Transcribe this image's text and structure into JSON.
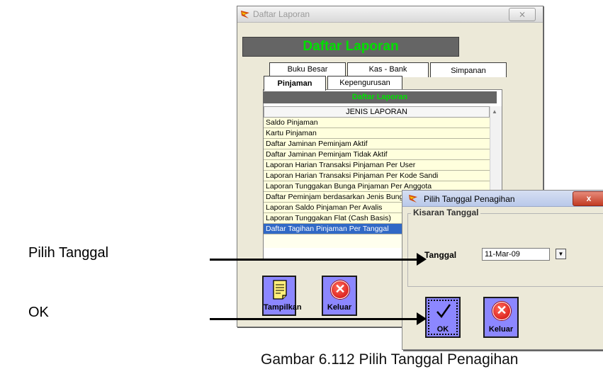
{
  "main_window": {
    "title": "Daftar Laporan",
    "close_glyph": "⨯",
    "header": "Daftar Laporan",
    "tabs_row1": [
      "Buku Besar",
      "Kas - Bank",
      "Simpanan"
    ],
    "tabs_row2": [
      "Pinjaman",
      "Kepengurusan"
    ],
    "active_tab": "Pinjaman",
    "sub_header": "Daftar Laporan",
    "list_header": "JENIS LAPORAN",
    "list_items": [
      "Saldo Pinjaman",
      "Kartu Pinjaman",
      "Daftar Jaminan Peminjam Aktif",
      "Daftar Jaminan Peminjam Tidak Aktif",
      "Laporan Harian Transaksi Pinjaman Per User",
      "Laporan Harian Transaksi Pinjaman Per Kode Sandi",
      "Laporan Tunggakan Bunga Pinjaman Per Anggota",
      "Daftar Peminjam berdasarkan Jenis Bunga",
      "Laporan Saldo Pinjaman Per Avalis",
      "Laporan Tunggakan Flat (Cash Basis)",
      "Daftar Tagihan Pinjaman Per Tanggal"
    ],
    "selected_item": "Daftar Tagihan Pinjaman Per Tanggal",
    "buttons": {
      "tampilkan": "Tampilkan",
      "keluar": "Keluar"
    }
  },
  "dialog": {
    "title": "Pilih Tanggal Penagihan",
    "close_glyph": "x",
    "group_label": "Kisaran Tanggal",
    "field_label": "Tanggal",
    "date_value": "11-Mar-09",
    "buttons": {
      "ok": "OK",
      "keluar": "Keluar"
    }
  },
  "annotations": {
    "pilih": "Pilih Tanggal",
    "ok": "OK"
  },
  "caption": "Gambar 6.112 Pilih Tanggal Penagihan",
  "colors": {
    "header_band": "#656565",
    "header_text": "#00e000",
    "button_bg": "#8c87ff",
    "selected_row": "#3169c6"
  }
}
